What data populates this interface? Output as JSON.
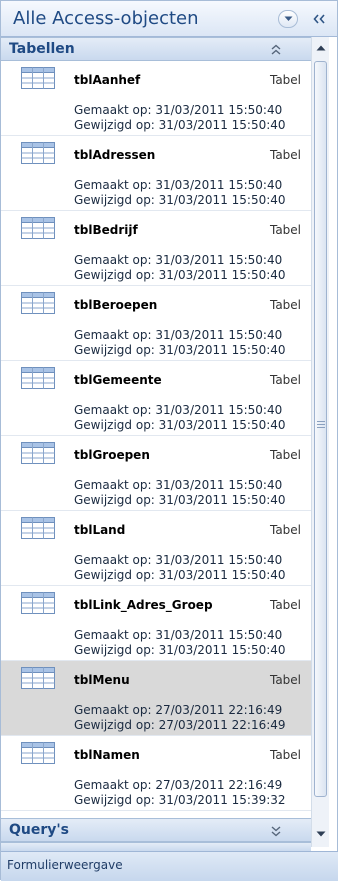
{
  "pane": {
    "title": "Alle Access-objecten"
  },
  "groups": [
    {
      "label": "Tabellen",
      "state": "expanded"
    },
    {
      "label": "Query's",
      "state": "collapsed"
    }
  ],
  "items": [
    {
      "name": "tblAanhef",
      "type": "Tabel",
      "created": "Gemaakt op: 31/03/2011 15:50:40",
      "modified": "Gewijzigd op: 31/03/2011 15:50:40",
      "selected": false
    },
    {
      "name": "tblAdressen",
      "type": "Tabel",
      "created": "Gemaakt op: 31/03/2011 15:50:40",
      "modified": "Gewijzigd op: 31/03/2011 15:50:40",
      "selected": false
    },
    {
      "name": "tblBedrijf",
      "type": "Tabel",
      "created": "Gemaakt op: 31/03/2011 15:50:40",
      "modified": "Gewijzigd op: 31/03/2011 15:50:40",
      "selected": false
    },
    {
      "name": "tblBeroepen",
      "type": "Tabel",
      "created": "Gemaakt op: 31/03/2011 15:50:40",
      "modified": "Gewijzigd op: 31/03/2011 15:50:40",
      "selected": false
    },
    {
      "name": "tblGemeente",
      "type": "Tabel",
      "created": "Gemaakt op: 31/03/2011 15:50:40",
      "modified": "Gewijzigd op: 31/03/2011 15:50:40",
      "selected": false
    },
    {
      "name": "tblGroepen",
      "type": "Tabel",
      "created": "Gemaakt op: 31/03/2011 15:50:40",
      "modified": "Gewijzigd op: 31/03/2011 15:50:40",
      "selected": false
    },
    {
      "name": "tblLand",
      "type": "Tabel",
      "created": "Gemaakt op: 31/03/2011 15:50:40",
      "modified": "Gewijzigd op: 31/03/2011 15:50:40",
      "selected": false
    },
    {
      "name": "tblLink_Adres_Groep",
      "type": "Tabel",
      "created": "Gemaakt op: 31/03/2011 15:50:40",
      "modified": "Gewijzigd op: 31/03/2011 15:50:40",
      "selected": false
    },
    {
      "name": "tblMenu",
      "type": "Tabel",
      "created": "Gemaakt op: 27/03/2011 22:16:49",
      "modified": "Gewijzigd op: 27/03/2011 22:16:49",
      "selected": true
    },
    {
      "name": "tblNamen",
      "type": "Tabel",
      "created": "Gemaakt op: 27/03/2011 22:16:49",
      "modified": "Gewijzigd op: 31/03/2011 15:39:32",
      "selected": false
    }
  ],
  "status_bar": {
    "text": "Formulierweergave"
  },
  "icons": {
    "pane_menu": "chevron-down-icon",
    "pane_collapse": "double-chevron-left-icon",
    "group_collapse": "double-chevron-up-icon",
    "group_expand": "double-chevron-down-icon",
    "table": "table-icon"
  },
  "colors": {
    "header_text": "#1f4a84",
    "selected_row": "#d9d9d9"
  }
}
